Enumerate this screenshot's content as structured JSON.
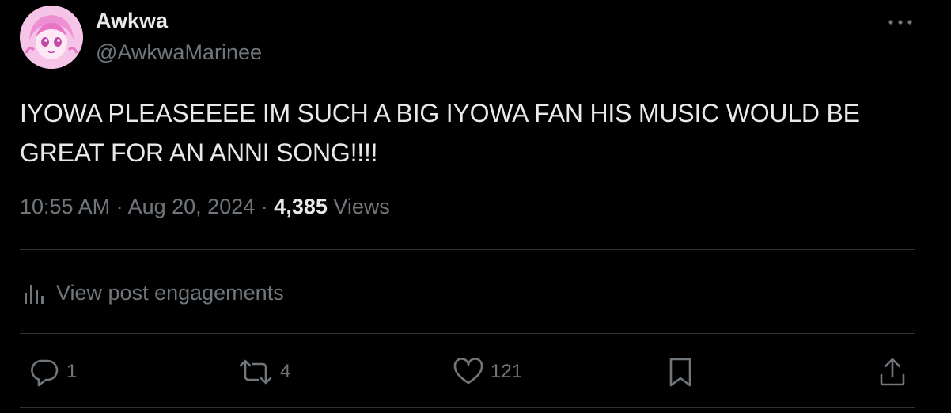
{
  "author": {
    "name": "Awkwa",
    "handle": "@AwkwaMarinee"
  },
  "post": {
    "text": "IYOWA PLEASEEEE IM SUCH A BIG IYOWA FAN HIS MUSIC WOULD BE GREAT FOR AN ANNI SONG!!!!",
    "time": "10:55 AM",
    "separator": "·",
    "date": "Aug 20, 2024",
    "views_count": "4,385",
    "views_label": "Views"
  },
  "engagements": {
    "label": "View post engagements",
    "icon": "analytics-icon"
  },
  "actions": {
    "reply": {
      "count": "1",
      "icon": "reply-icon"
    },
    "repost": {
      "count": "4",
      "icon": "repost-icon"
    },
    "like": {
      "count": "121",
      "icon": "heart-icon"
    },
    "bookmark": {
      "icon": "bookmark-icon"
    },
    "share": {
      "icon": "share-icon"
    }
  },
  "colors": {
    "background": "#000000",
    "text_primary": "#e7e9ea",
    "text_secondary": "#71767b",
    "divider": "#2f3336",
    "avatar_pink": "#f1a2da"
  }
}
